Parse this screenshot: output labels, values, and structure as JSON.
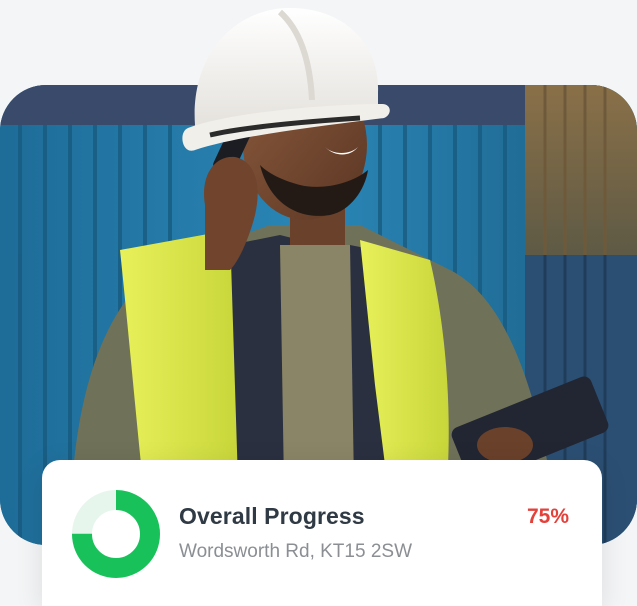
{
  "progress_card": {
    "title": "Overall Progress",
    "address": "Wordsworth Rd, KT15 2SW",
    "percent_label": "75%",
    "progress_fraction": 0.75
  },
  "colors": {
    "progress_fill": "#19c15a",
    "progress_track": "#e6f6ec",
    "percent_text": "#e4413b",
    "title_text": "#2f3a45"
  },
  "photo": {
    "subject": "construction-worker-on-phone-with-tablet"
  }
}
